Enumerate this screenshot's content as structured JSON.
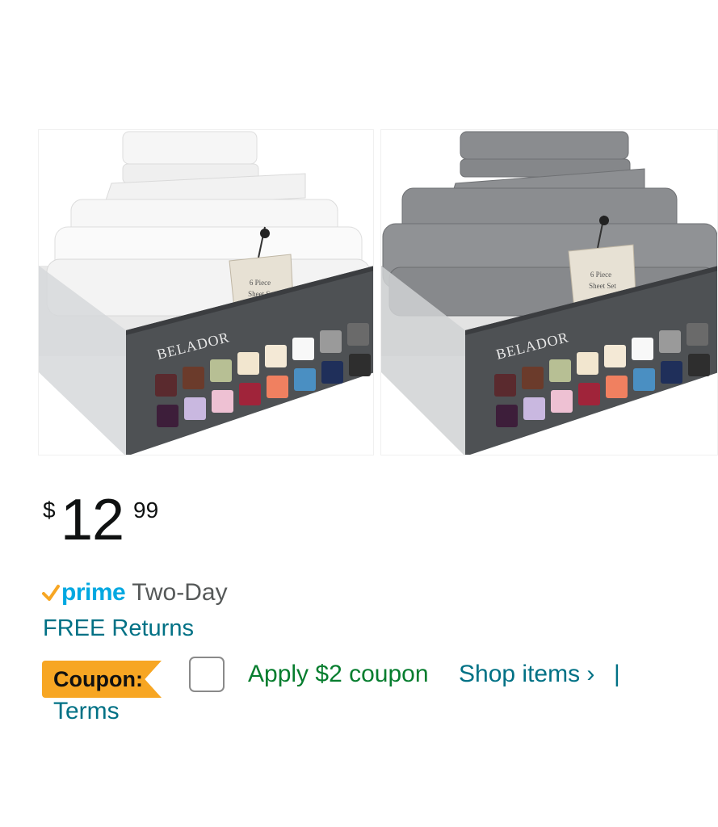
{
  "products": [
    {
      "color_name": "white",
      "sheet_color": "#f4f4f4",
      "sheet_shade": "#dcdcdc",
      "brand": "BELADOR",
      "tag_line1": "6 Piece",
      "tag_line2": "Sheet Set"
    },
    {
      "color_name": "gray",
      "sheet_color": "#8b8d90",
      "sheet_shade": "#6e7073",
      "brand": "BELADOR",
      "tag_line1": "6 Piece",
      "tag_line2": "Sheet Set"
    }
  ],
  "swatches": [
    "#5a2a2e",
    "#6b3b2b",
    "#b7bf94",
    "#f2e6cf",
    "#f4e9d6",
    "#f8f8f8",
    "#9a9a9a",
    "#6a6a6a",
    "#3d1e3a",
    "#c9b8e0",
    "#eec1d3",
    "#a0243a",
    "#f08060",
    "#4a8fc2",
    "#1f2f5a",
    "#2e2e2e"
  ],
  "price": {
    "currency": "$",
    "whole": "12",
    "fraction": "99"
  },
  "prime": {
    "word": "prime",
    "delivery": "Two-Day",
    "accent": "#00a8e1",
    "check_color": "#f7a623"
  },
  "returns": {
    "label": "FREE Returns"
  },
  "coupon": {
    "badge": "Coupon:",
    "apply": "Apply $2 coupon",
    "shop_items": "Shop items ›",
    "separator": "|",
    "terms": "Terms"
  }
}
